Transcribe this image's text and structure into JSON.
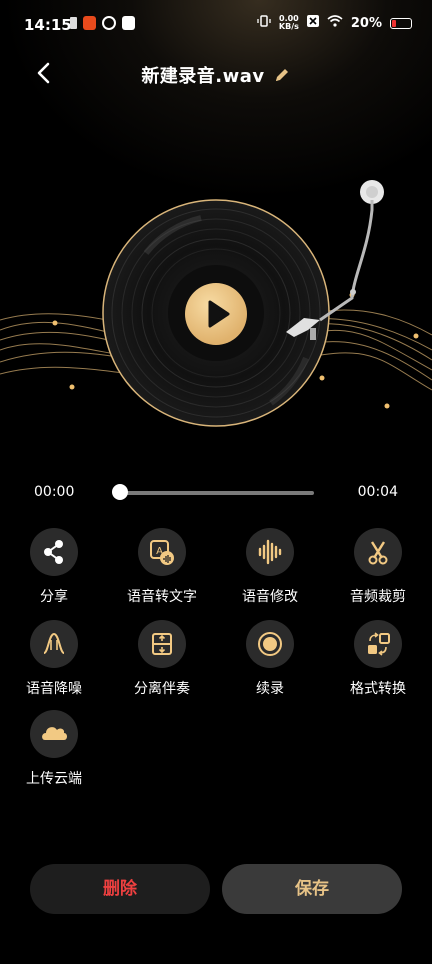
{
  "status_bar": {
    "time": "14:15",
    "net_speed_value": "0.00",
    "net_speed_unit": "KB/s",
    "battery": "20%"
  },
  "header": {
    "title": "新建录音.wav"
  },
  "player": {
    "current_time": "00:00",
    "total_time": "00:04",
    "progress": 0
  },
  "tools": [
    {
      "label": "分享",
      "icon": "share-icon"
    },
    {
      "label": "语音转文字",
      "icon": "speech-to-text-icon"
    },
    {
      "label": "语音修改",
      "icon": "waveform-icon"
    },
    {
      "label": "音频裁剪",
      "icon": "scissors-icon"
    },
    {
      "label": "语音降噪",
      "icon": "noise-reduction-icon"
    },
    {
      "label": "分离伴奏",
      "icon": "separate-icon"
    },
    {
      "label": "续录",
      "icon": "record-icon"
    },
    {
      "label": "格式转换",
      "icon": "convert-icon"
    },
    {
      "label": "上传云端",
      "icon": "cloud-upload-icon"
    }
  ],
  "actions": {
    "delete_label": "删除",
    "save_label": "保存"
  },
  "colors": {
    "accent_gold": "#e7c387",
    "delete_red": "#ee4040",
    "background": "#000000"
  }
}
